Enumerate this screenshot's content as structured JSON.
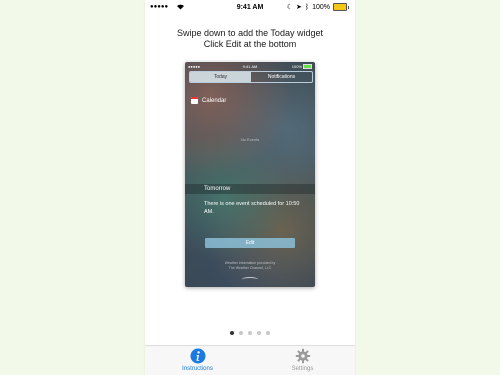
{
  "status_bar": {
    "signal": "●●●●●",
    "time": "9:41 AM",
    "battery_percent": "100%"
  },
  "heading": {
    "line1": "Swipe down to add the Today widget",
    "line2": "Click Edit at the bottom"
  },
  "screenshot": {
    "status": {
      "signal": "●●●●●",
      "time": "9:41 AM",
      "battery": "100%"
    },
    "tabs": [
      {
        "label": "Today",
        "active": true
      },
      {
        "label": "Notifications",
        "active": false
      }
    ],
    "calendar_label": "Calendar",
    "no_events": "No Events",
    "tomorrow_label": "Tomorrow",
    "event_text": "There is one event scheduled for 10:50 AM.",
    "edit_label": "Edit",
    "credit_line1": "Weather information provided by",
    "credit_line2": "The Weather Channel, LLC"
  },
  "page_dots": {
    "count": 5,
    "active_index": 0
  },
  "tabbar": {
    "items": [
      {
        "label": "Instructions",
        "icon": "info-icon",
        "active": true
      },
      {
        "label": "Settings",
        "icon": "gear-icon",
        "active": false
      }
    ],
    "active_color": "#1a7ae0",
    "inactive_color": "#9a9a9a"
  }
}
